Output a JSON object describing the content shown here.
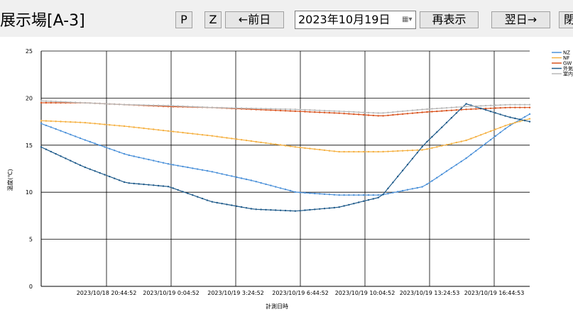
{
  "toolbar": {
    "title": "展示場[A-3]",
    "btn_p": "P",
    "btn_z": "Z",
    "btn_prev": "←前日",
    "date_value": "2023年10月19日",
    "btn_refresh": "再表示",
    "btn_next": "翌日→",
    "btn_close": "閉"
  },
  "chart_data": {
    "type": "line",
    "ylabel": "温度(℃)",
    "xlabel": "計測日時",
    "ylim": [
      0,
      25
    ],
    "yticks": [
      "0",
      "5",
      "10",
      "15",
      "20",
      "25"
    ],
    "xticks": [
      "2023/10/18 20:44:52",
      "2023/10/19 0:04:52",
      "2023/10/19 3:24:52",
      "2023/10/19 6:44:52",
      "2023/10/19 10:04:52",
      "2023/10/19 13:24:53",
      "2023/10/19 16:44:53"
    ],
    "x_hours": [
      -4.0,
      -2.0,
      0.0,
      2.0,
      4.0,
      6.0,
      8.0,
      10.0,
      12.0,
      14.0,
      16.0,
      18.0,
      19.0
    ],
    "grid": true,
    "legend_position": "top-right",
    "series": [
      {
        "name": "NZ",
        "color": "#4a90d9",
        "y": [
          17.3,
          15.6,
          14.0,
          13.0,
          12.2,
          11.2,
          10.0,
          9.7,
          9.7,
          10.6,
          13.6,
          17.0,
          18.3
        ]
      },
      {
        "name": "NF",
        "color": "#f5b041",
        "y": [
          17.6,
          17.4,
          17.0,
          16.5,
          16.0,
          15.4,
          14.8,
          14.3,
          14.3,
          14.5,
          15.5,
          17.2,
          17.8
        ]
      },
      {
        "name": "GW",
        "color": "#d9531e",
        "y": [
          19.5,
          19.5,
          19.3,
          19.1,
          19.0,
          18.8,
          18.6,
          18.4,
          18.1,
          18.5,
          18.8,
          19.0,
          19.0
        ]
      },
      {
        "name": "外気",
        "color": "#1e5a8a",
        "y": [
          14.8,
          12.7,
          11.0,
          10.6,
          9.0,
          8.2,
          8.0,
          8.4,
          9.5,
          15.0,
          19.4,
          18.0,
          17.5
        ]
      },
      {
        "name": "室内",
        "color": "#b8b8b8",
        "y": [
          19.7,
          19.5,
          19.3,
          19.2,
          19.0,
          18.9,
          18.8,
          18.6,
          18.4,
          18.8,
          19.1,
          19.3,
          19.3
        ]
      }
    ]
  }
}
